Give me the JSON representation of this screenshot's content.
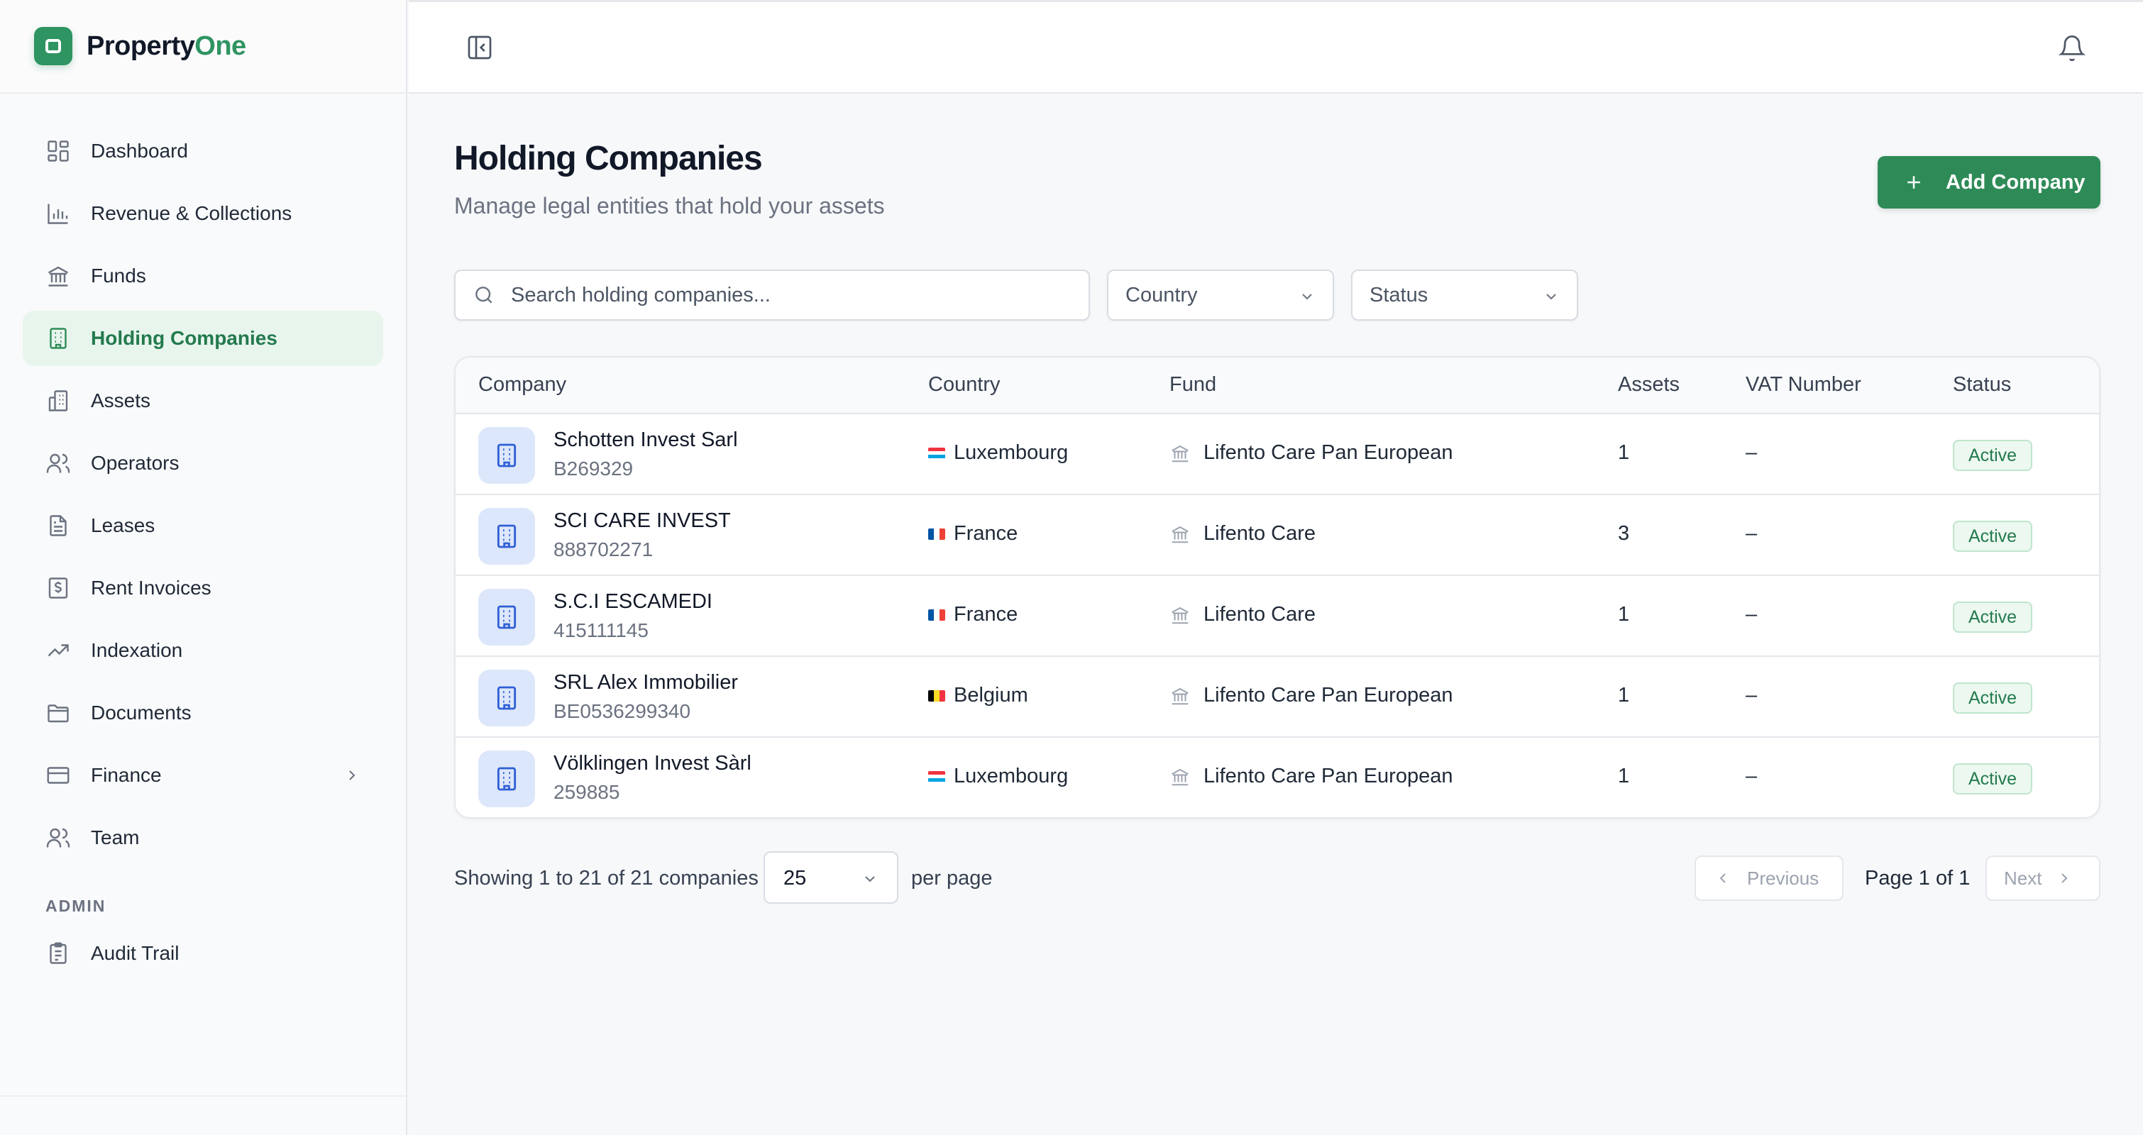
{
  "app": {
    "brand_part1": "Property",
    "brand_part2": "One",
    "accent_color": "#2e8b57"
  },
  "sidebar": {
    "items": [
      {
        "label": "Dashboard",
        "icon": "dashboard-icon"
      },
      {
        "label": "Revenue & Collections",
        "icon": "bar-chart-icon"
      },
      {
        "label": "Funds",
        "icon": "bank-icon"
      },
      {
        "label": "Holding Companies",
        "icon": "building-icon",
        "active": true
      },
      {
        "label": "Assets",
        "icon": "buildings-icon"
      },
      {
        "label": "Operators",
        "icon": "users-icon"
      },
      {
        "label": "Leases",
        "icon": "file-text-icon"
      },
      {
        "label": "Rent Invoices",
        "icon": "invoice-dollar-icon"
      },
      {
        "label": "Indexation",
        "icon": "trending-up-icon"
      },
      {
        "label": "Documents",
        "icon": "folder-icon"
      },
      {
        "label": "Finance",
        "icon": "credit-card-icon",
        "has_submenu": true
      },
      {
        "label": "Team",
        "icon": "users-icon"
      }
    ],
    "admin_section_label": "ADMIN",
    "admin_items": [
      {
        "label": "Audit Trail",
        "icon": "clipboard-icon"
      }
    ]
  },
  "topbar": {
    "toggle_icon": "sidebar-toggle-icon",
    "bell_icon": "bell-icon"
  },
  "header": {
    "title": "Holding Companies",
    "subtitle": "Manage legal entities that hold your assets",
    "add_button_label": "Add Company"
  },
  "filters": {
    "search_placeholder": "Search holding companies...",
    "country_label": "Country",
    "status_label": "Status"
  },
  "table": {
    "columns": [
      "Company",
      "Country",
      "Fund",
      "Assets",
      "VAT Number",
      "Status"
    ],
    "rows": [
      {
        "name": "Schotten Invest Sarl",
        "id": "B269329",
        "country": "Luxembourg",
        "flag": "lu",
        "fund": "Lifento Care Pan European",
        "assets": "1",
        "vat": "–",
        "status": "Active"
      },
      {
        "name": "SCI CARE INVEST",
        "id": "888702271",
        "country": "France",
        "flag": "fr",
        "fund": "Lifento Care",
        "assets": "3",
        "vat": "–",
        "status": "Active"
      },
      {
        "name": "S.C.I ESCAMEDI",
        "id": "415111145",
        "country": "France",
        "flag": "fr",
        "fund": "Lifento Care",
        "assets": "1",
        "vat": "–",
        "status": "Active"
      },
      {
        "name": "SRL Alex Immobilier",
        "id": "BE0536299340",
        "country": "Belgium",
        "flag": "be",
        "fund": "Lifento Care Pan European",
        "assets": "1",
        "vat": "–",
        "status": "Active"
      },
      {
        "name": "Völklingen Invest Sàrl",
        "id": "259885",
        "country": "Luxembourg",
        "flag": "lu",
        "fund": "Lifento Care Pan European",
        "assets": "1",
        "vat": "–",
        "status": "Active"
      }
    ]
  },
  "pagination": {
    "showing_text": "Showing 1 to 21 of 21 companies",
    "per_page_value": "25",
    "per_page_text": "per page",
    "previous_label": "Previous",
    "page_text": "Page 1 of 1",
    "next_label": "Next"
  }
}
